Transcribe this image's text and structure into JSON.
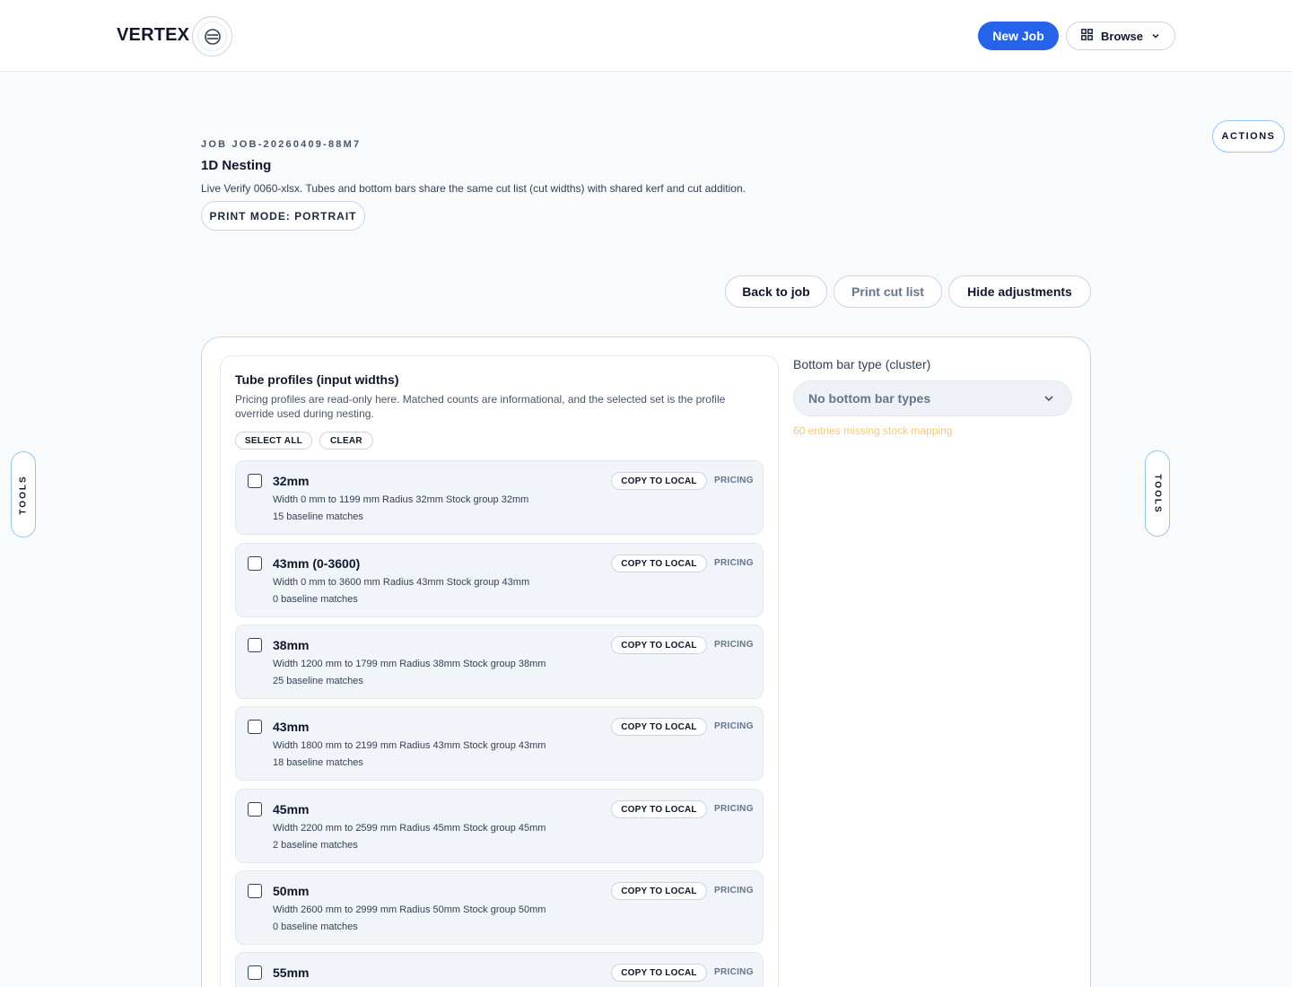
{
  "header": {
    "brand": "VERTEX",
    "new_job_label": "New Job",
    "browse_label": "Browse"
  },
  "rails": {
    "left_label": "TOOLS",
    "right_label": "TOOLS",
    "actions_label": "ACTIONS"
  },
  "job": {
    "id": "JOB JOB-20260409-88M7",
    "title": "1D Nesting",
    "description": "Live Verify 0060-xlsx. Tubes and bottom bars share the same cut list (cut widths) with shared kerf and cut addition.",
    "print_mode": "PRINT MODE: PORTRAIT"
  },
  "toolbar": {
    "back_label": "Back to job",
    "print_label": "Print cut list",
    "hide_label": "Hide adjustments"
  },
  "profiles": {
    "title": "Tube profiles (input widths)",
    "description": "Pricing profiles are read-only here. Matched counts are informational, and the selected set is the profile override used during nesting.",
    "select_all_label": "SELECT ALL",
    "clear_label": "CLEAR",
    "copy_label": "COPY TO LOCAL",
    "pricing_label": "PRICING",
    "items": [
      {
        "name": "32mm",
        "meta": "Width 0 mm to 1199 mm   Radius 32mm   Stock group 32mm",
        "matches": "15 baseline matches"
      },
      {
        "name": "43mm (0-3600)",
        "meta": "Width 0 mm to 3600 mm   Radius 43mm   Stock group 43mm",
        "matches": "0 baseline matches"
      },
      {
        "name": "38mm",
        "meta": "Width 1200 mm to 1799 mm   Radius 38mm   Stock group 38mm",
        "matches": "25 baseline matches"
      },
      {
        "name": "43mm",
        "meta": "Width 1800 mm to 2199 mm   Radius 43mm   Stock group 43mm",
        "matches": "18 baseline matches"
      },
      {
        "name": "45mm",
        "meta": "Width 2200 mm to 2599 mm   Radius 45mm   Stock group 45mm",
        "matches": "2 baseline matches"
      },
      {
        "name": "50mm",
        "meta": "Width 2600 mm to 2999 mm   Radius 50mm   Stock group 50mm",
        "matches": "0 baseline matches"
      },
      {
        "name": "55mm",
        "meta": "",
        "matches": ""
      }
    ]
  },
  "bottom_bar": {
    "label": "Bottom bar type (cluster)",
    "selected": "No bottom bar types",
    "warning": "60 entries missing stock mapping"
  },
  "colors": {
    "accent": "#2563eb",
    "warning": "#f5c878"
  }
}
